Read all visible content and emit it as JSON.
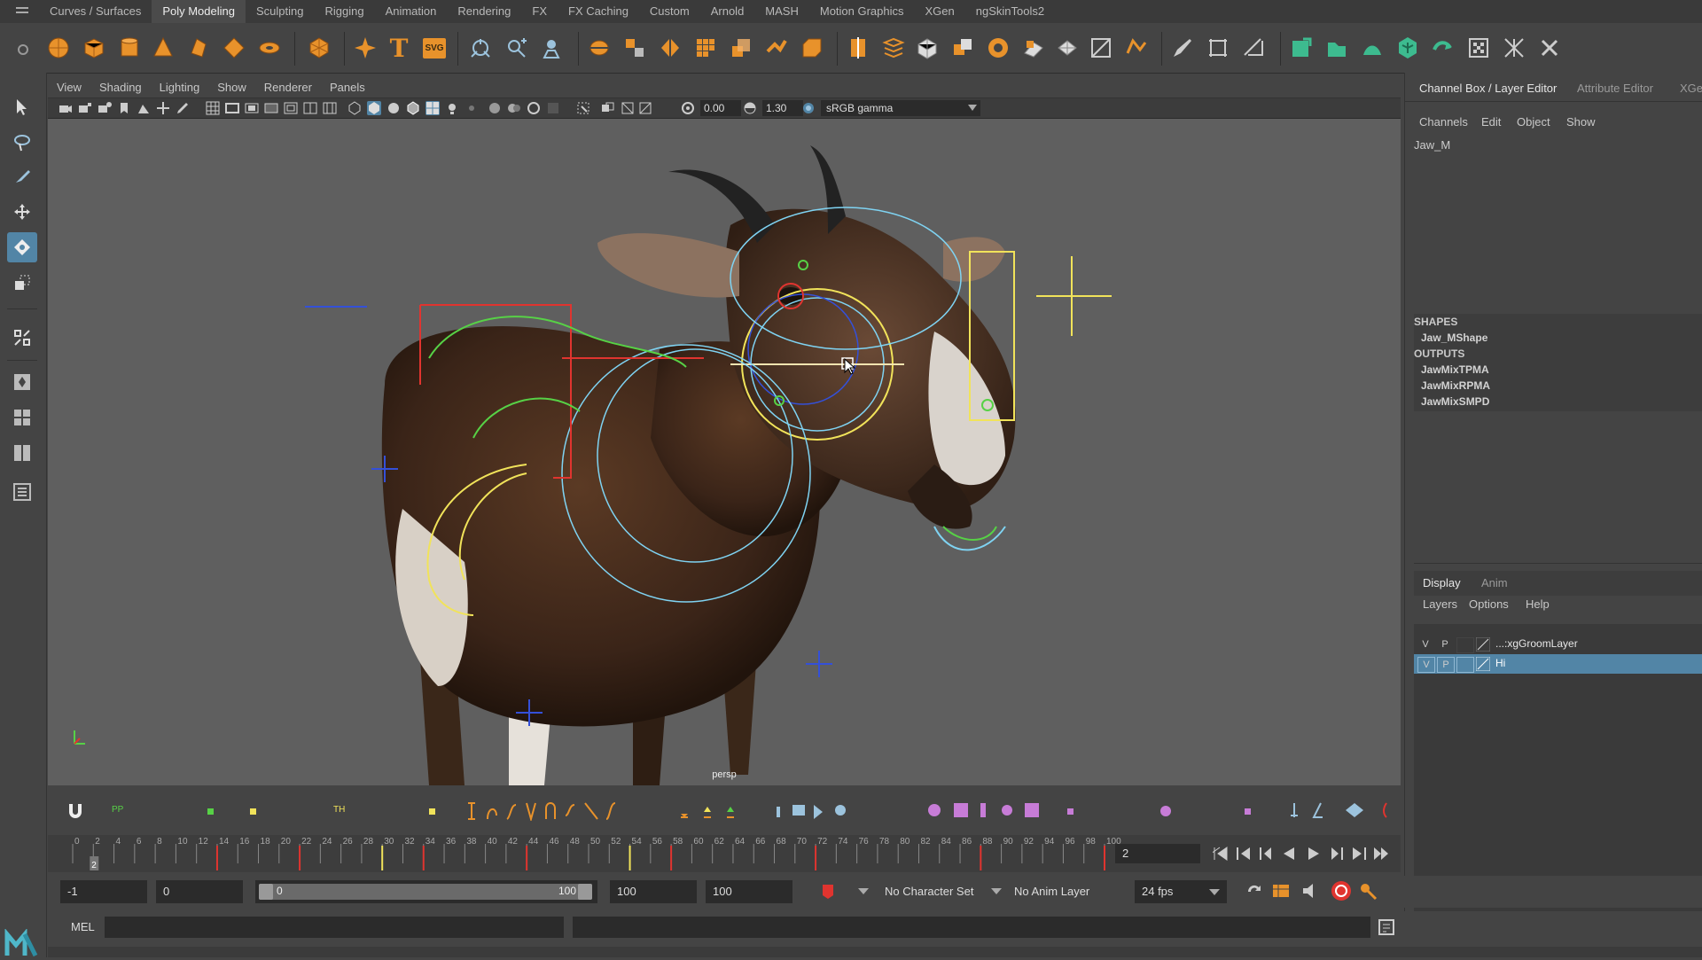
{
  "shelf": {
    "tabs": [
      {
        "label": "Curves / Surfaces"
      },
      {
        "label": "Poly Modeling"
      },
      {
        "label": "Sculpting"
      },
      {
        "label": "Rigging"
      },
      {
        "label": "Animation"
      },
      {
        "label": "Rendering"
      },
      {
        "label": "FX"
      },
      {
        "label": "FX Caching"
      },
      {
        "label": "Custom"
      },
      {
        "label": "Arnold"
      },
      {
        "label": "MASH"
      },
      {
        "label": "Motion Graphics"
      },
      {
        "label": "XGen"
      },
      {
        "label": "ngSkinTools2"
      }
    ],
    "active_tab": "Poly Modeling",
    "text_icon_label": "T",
    "svg_icon_label": "SVG"
  },
  "viewport": {
    "menu": [
      {
        "label": "View"
      },
      {
        "label": "Shading"
      },
      {
        "label": "Lighting"
      },
      {
        "label": "Show"
      },
      {
        "label": "Renderer"
      },
      {
        "label": "Panels"
      }
    ],
    "exposure": "0.00",
    "gamma": "1.30",
    "color_space": "sRGB gamma",
    "camera_label": "persp"
  },
  "channel_box": {
    "tabs": [
      {
        "label": "Channel Box / Layer Editor"
      },
      {
        "label": "Attribute Editor"
      },
      {
        "label": "XGe"
      }
    ],
    "menu": [
      {
        "label": "Channels"
      },
      {
        "label": "Edit"
      },
      {
        "label": "Object"
      },
      {
        "label": "Show"
      }
    ],
    "object_name": "Jaw_M",
    "shapes_header": "SHAPES",
    "shapes": [
      "Jaw_MShape"
    ],
    "outputs_header": "OUTPUTS",
    "outputs": [
      "JawMixTPMA",
      "JawMixRPMA",
      "JawMixSMPD"
    ]
  },
  "layer_editor": {
    "tabs": [
      {
        "label": "Display"
      },
      {
        "label": "Anim"
      }
    ],
    "menu": [
      {
        "label": "Layers"
      },
      {
        "label": "Options"
      },
      {
        "label": "Help"
      }
    ],
    "layers": [
      {
        "v": "V",
        "p": "P",
        "name": "...:xgGroomLayer",
        "selected": false
      },
      {
        "v": "V",
        "p": "P",
        "name": "Hi",
        "selected": true
      }
    ]
  },
  "timeline": {
    "ticks": [
      "0",
      "2",
      "4",
      "6",
      "8",
      "10",
      "12",
      "14",
      "16",
      "18",
      "20",
      "22",
      "24",
      "26",
      "28",
      "30",
      "32",
      "34",
      "36",
      "38",
      "40",
      "42",
      "44",
      "46",
      "48",
      "50",
      "52",
      "54",
      "56",
      "58",
      "60",
      "62",
      "64",
      "66",
      "68",
      "70",
      "72",
      "74",
      "76",
      "78",
      "80",
      "82",
      "84",
      "86",
      "88",
      "90",
      "92",
      "94",
      "96",
      "98",
      "100"
    ],
    "current_frame": "2",
    "current_frame_field": "2",
    "tool_labels": {
      "pp": "PP",
      "th": "TH"
    }
  },
  "range": {
    "start_time": "-1",
    "playback_start": "0",
    "slider_start": "0",
    "slider_end": "100",
    "playback_end": "100",
    "end_time": "100",
    "character_set": "No Character Set",
    "anim_layer": "No Anim Layer",
    "fps": "24 fps"
  },
  "command_line": {
    "mode_label": "MEL",
    "value": ""
  },
  "colors": {
    "accent": "#5285a6",
    "shelf_orange": "#e8922b",
    "shelf_green": "#3dbb8f",
    "control_yellow": "#f1e35a",
    "control_cyan": "#7fd3f2",
    "control_red": "#e0342f",
    "control_green": "#57d146",
    "control_blue": "#3450d8"
  }
}
